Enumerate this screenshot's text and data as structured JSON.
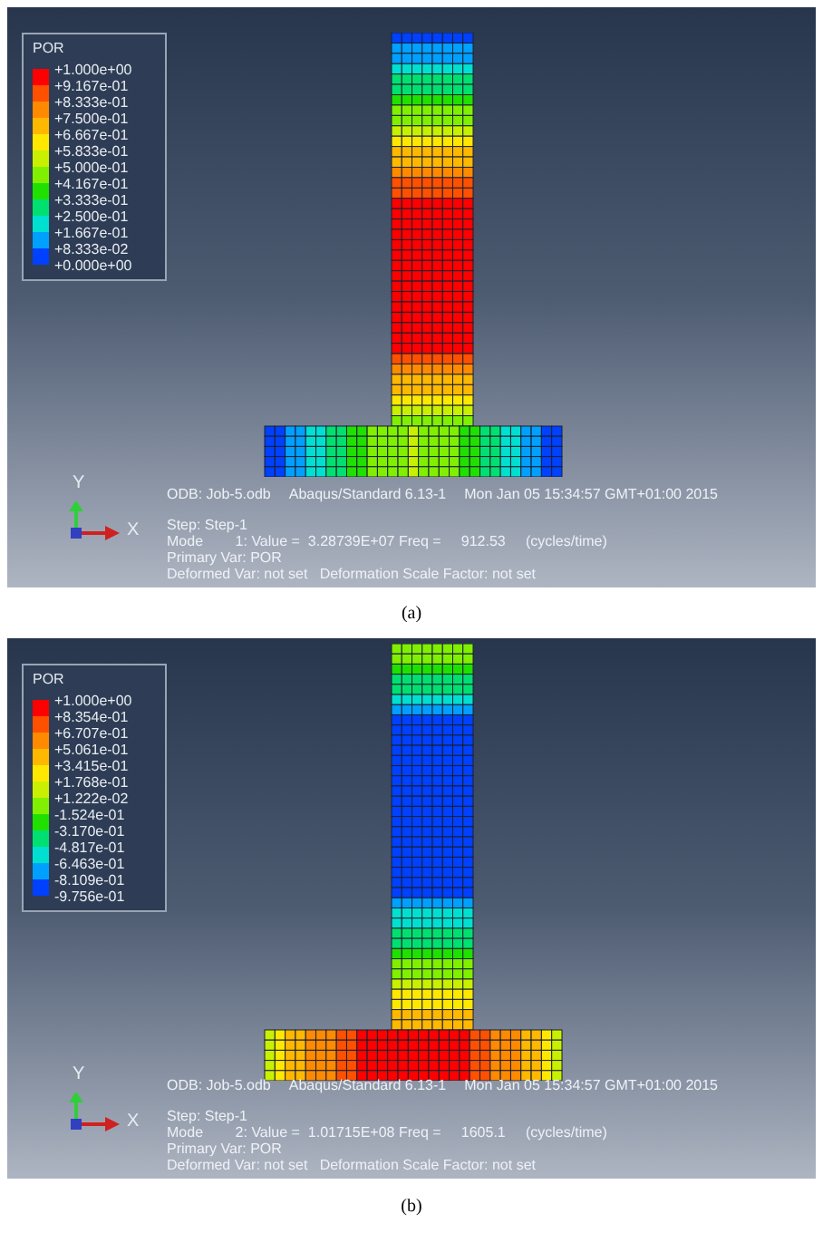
{
  "panels": [
    {
      "legend": {
        "title": "POR",
        "labels": [
          "+1.000e+00",
          "+9.167e-01",
          "+8.333e-01",
          "+7.500e-01",
          "+6.667e-01",
          "+5.833e-01",
          "+5.000e-01",
          "+4.167e-01",
          "+3.333e-01",
          "+2.500e-01",
          "+1.667e-01",
          "+8.333e-02",
          "+0.000e+00"
        ]
      },
      "triad": {
        "y": "Y",
        "x": "X"
      },
      "odb": "ODB: Job-5.odb",
      "solver": "Abaqus/Standard 6.13-1",
      "timestamp": "Mon Jan 05 15:34:57 GMT+01:00 2015",
      "step": "Step: Step-1",
      "mode": "Mode        1: Value =  3.28739E+07 Freq =     912.53     (cycles/time)",
      "primary_var": "Primary Var: POR",
      "deformed_var": "Deformed Var: not set   Deformation Scale Factor: not set",
      "caption": "(a)"
    },
    {
      "legend": {
        "title": "POR",
        "labels": [
          "+1.000e+00",
          "+8.354e-01",
          "+6.707e-01",
          "+5.061e-01",
          "+3.415e-01",
          "+1.768e-01",
          "+1.222e-02",
          "-1.524e-01",
          "-3.170e-01",
          "-4.817e-01",
          "-6.463e-01",
          "-8.109e-01",
          "-9.756e-01"
        ]
      },
      "triad": {
        "y": "Y",
        "x": "X"
      },
      "odb": "ODB: Job-5.odb",
      "solver": "Abaqus/Standard 6.13-1",
      "timestamp": "Mon Jan 05 15:34:57 GMT+01:00 2015",
      "step": "Step: Step-1",
      "mode": "Mode        2: Value =  1.01715E+08 Freq =     1605.1     (cycles/time)",
      "primary_var": "Primary Var: POR",
      "deformed_var": "Deformed Var: not set   Deformation Scale Factor: not set",
      "caption": "(b)"
    }
  ]
}
